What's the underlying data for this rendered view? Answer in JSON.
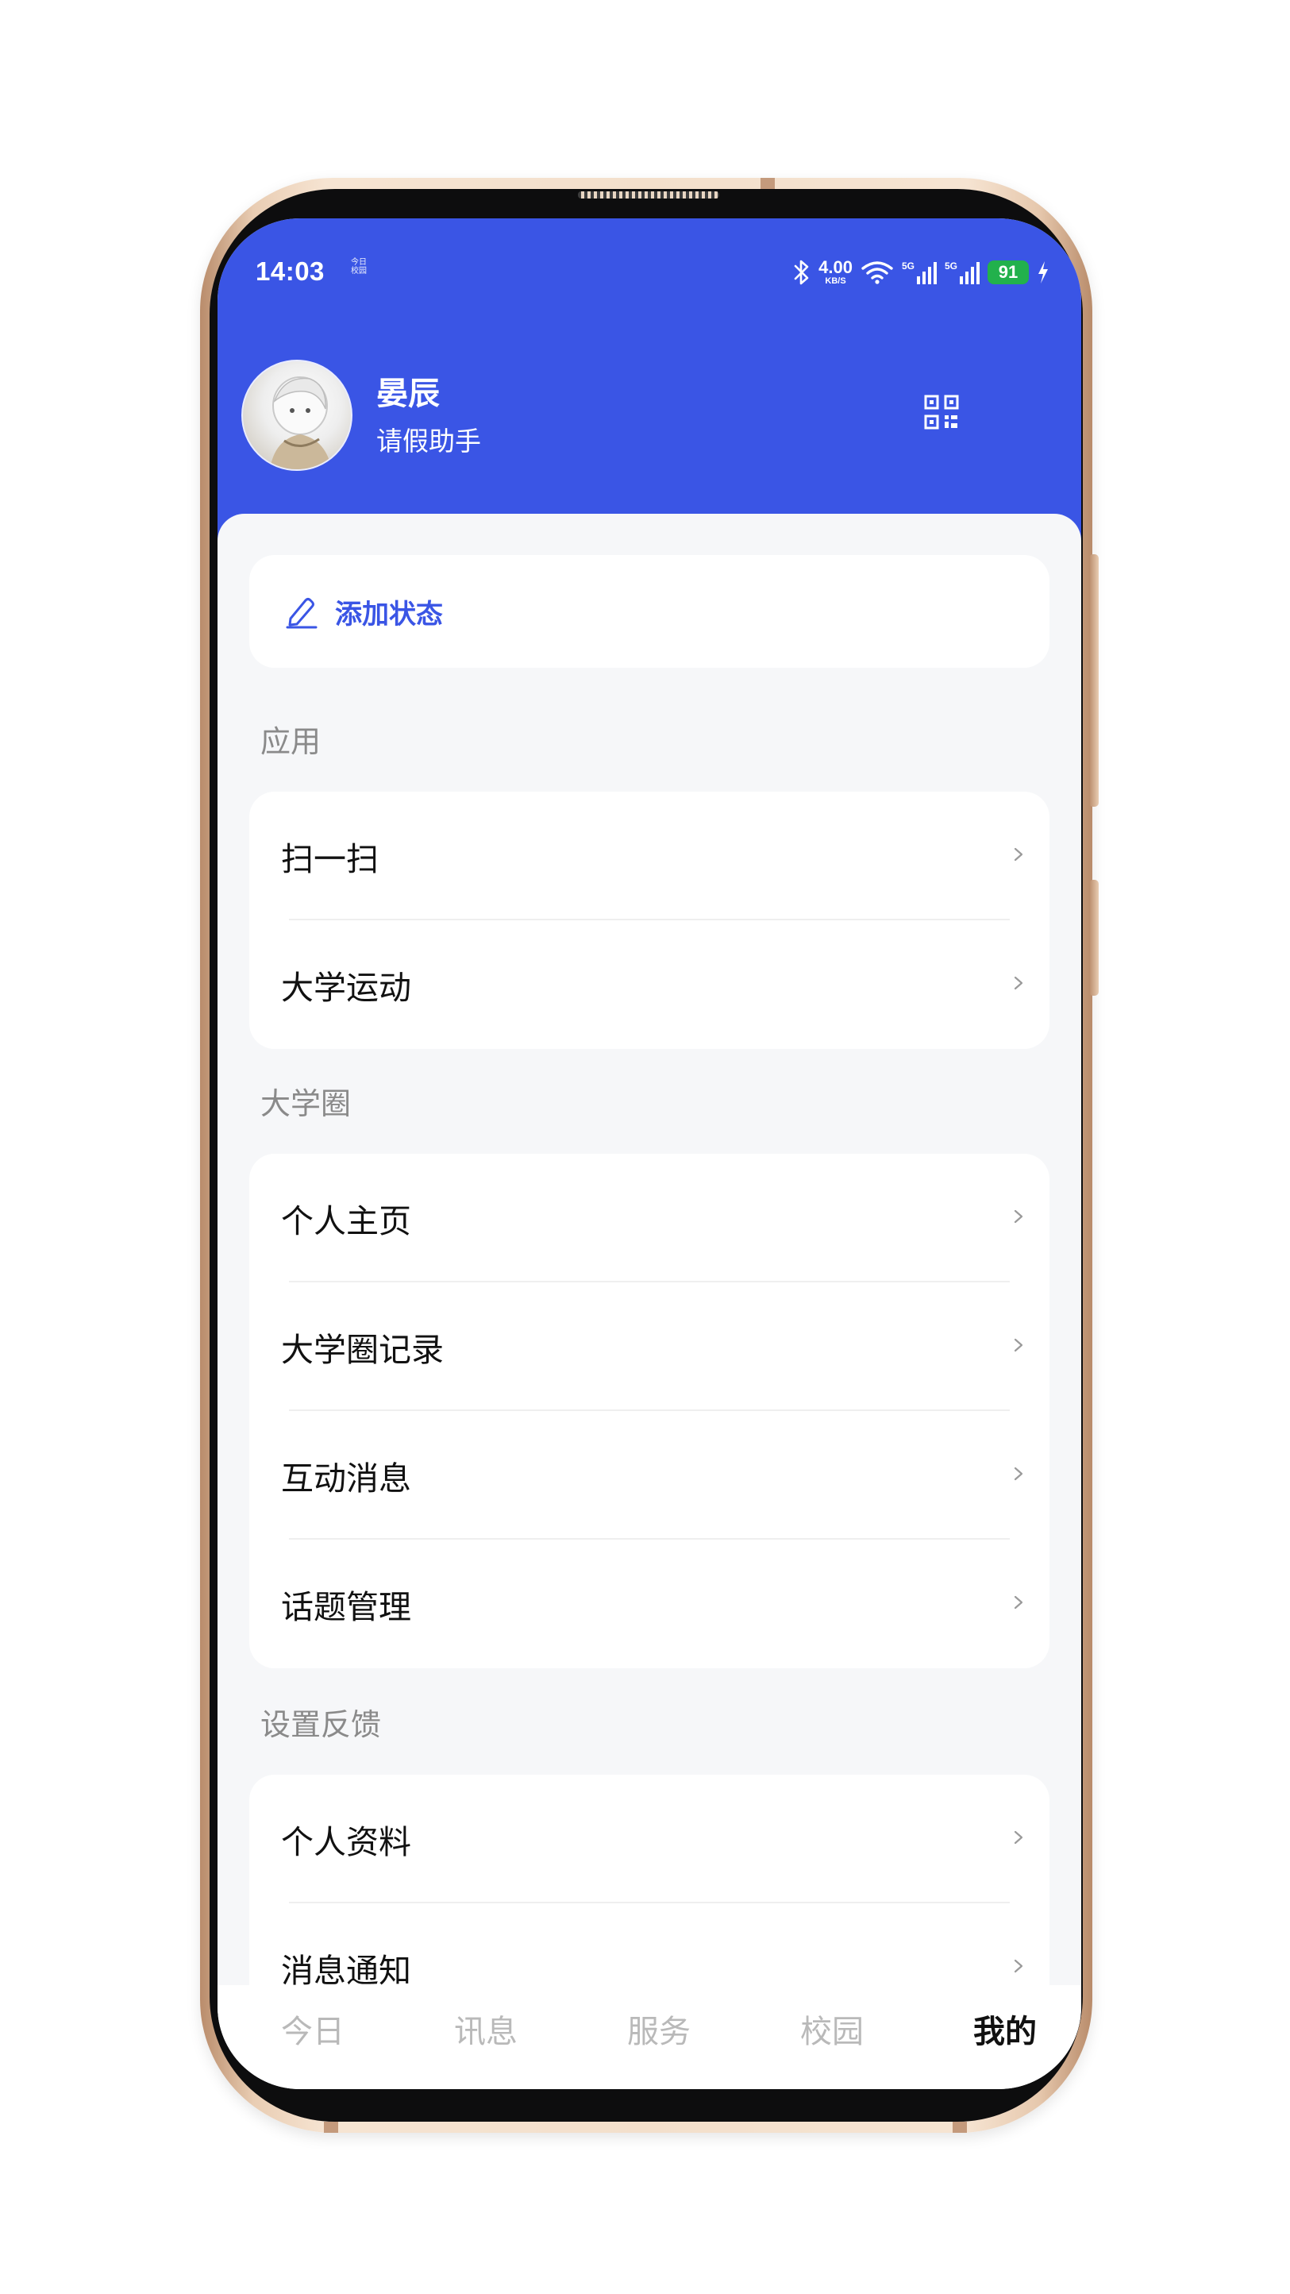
{
  "status_bar": {
    "time": "14:03",
    "mini_text_line1": "今日",
    "mini_text_line2": "校园",
    "net_speed_value": "4.00",
    "net_speed_unit": "KB/S",
    "signal1_label": "5G",
    "signal2_label": "5G",
    "battery_level": "91",
    "icons": [
      "bluetooth-icon",
      "wifi-icon",
      "signal-icon",
      "signal-icon",
      "battery-icon",
      "charging-icon"
    ]
  },
  "profile": {
    "name": "晏辰",
    "subtitle": "请假助手",
    "qr_icon": "qr-code-icon"
  },
  "status_card": {
    "icon": "edit-icon",
    "label": "添加状态"
  },
  "sections": [
    {
      "title": "应用",
      "items": [
        {
          "label": "扫一扫"
        },
        {
          "label": "大学运动"
        }
      ]
    },
    {
      "title": "大学圈",
      "items": [
        {
          "label": "个人主页"
        },
        {
          "label": "大学圈记录"
        },
        {
          "label": "互动消息"
        },
        {
          "label": "话题管理"
        }
      ]
    },
    {
      "title": "设置反馈",
      "items": [
        {
          "label": "个人资料"
        },
        {
          "label": "消息通知"
        }
      ]
    }
  ],
  "tab_bar": {
    "tabs": [
      {
        "label": "今日"
      },
      {
        "label": "讯息"
      },
      {
        "label": "服务"
      },
      {
        "label": "校园"
      },
      {
        "label": "我的"
      }
    ],
    "active_index": 4
  },
  "colors": {
    "brand_blue": "#3a55e5",
    "battery_green": "#22b14c",
    "background": "#f6f7f9"
  }
}
